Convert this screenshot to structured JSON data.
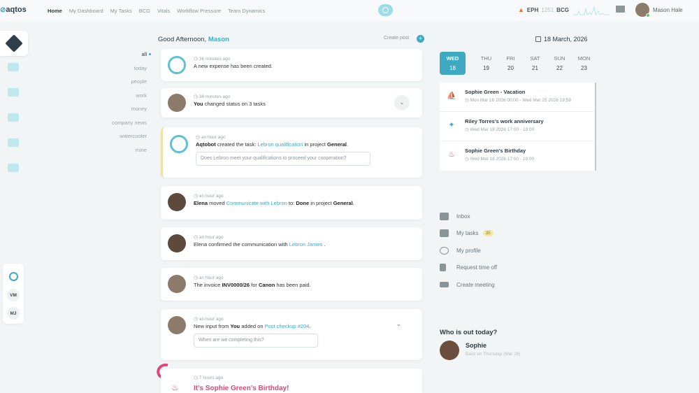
{
  "app": {
    "logo": "aqtos"
  },
  "nav": [
    "Home",
    "My Dashboard",
    "My Tasks",
    "BCG",
    "Vitals",
    "Workflow Pressure",
    "Team Dynamics"
  ],
  "ticker": {
    "eph_label": "EPH",
    "eph_value": "1251",
    "bcg_label": "BCG"
  },
  "user": {
    "name": "Mason Hale"
  },
  "greeting": {
    "prefix": "Good Afternoon,",
    "name": "Mason"
  },
  "create_post": "Create post",
  "filters": [
    "all",
    "today",
    "people",
    "work",
    "money",
    "company news",
    "watercooler",
    "mine"
  ],
  "feed": [
    {
      "time": "36 minutes ago",
      "text": "A new expense has been created."
    },
    {
      "time": "38 minutes ago",
      "actor": "You",
      "text": " changed status on 3 tasks"
    },
    {
      "time": "an hour ago",
      "actor": "Aqtobot",
      "pre": " created the task: ",
      "link": "Lebron qualification",
      "mid": " in project ",
      "project": "General",
      "end": ".",
      "reply_placeholder": "Does Lebron meet your qualifications to proceed your cooperation?"
    },
    {
      "time": "an hour ago",
      "actor": "Elena",
      "pre": " moved ",
      "link": "Communicate with Lebron",
      "mid": " to: ",
      "status": "Done",
      "mid2": " in project ",
      "project": "General",
      "end": "."
    },
    {
      "time": "an hour ago",
      "text": "Elena confirmed the communication with ",
      "link": "Lebron James",
      "end": " ."
    },
    {
      "time": "an hour ago",
      "pre": "The invoice ",
      "invoice": "INV0000/26",
      "mid": " for ",
      "client": "Canon",
      "end": " has been paid."
    },
    {
      "time": "an hour ago",
      "pre": "New input from ",
      "actor": "You",
      "mid": " added on ",
      "link": "Post checkup #204",
      "end": ".",
      "reply_placeholder": "When are we completing this?"
    },
    {
      "time": "7 hours ago",
      "title": "It's Sophie Green's Birthday!"
    }
  ],
  "calendar": {
    "date": "18 March, 2026",
    "days": [
      {
        "name": "WED",
        "num": "18"
      },
      {
        "name": "THU",
        "num": "19"
      },
      {
        "name": "FRI",
        "num": "20"
      },
      {
        "name": "SAT",
        "num": "21"
      },
      {
        "name": "SUN",
        "num": "22"
      },
      {
        "name": "MON",
        "num": "23"
      }
    ],
    "events": [
      {
        "title": "Sophie Green - Vacation",
        "date": "Mon Mar 16 2026 00:00 - Wed Mar 25 2026 19:59"
      },
      {
        "title": "Riley Torres's work anniversary",
        "date": "Wed Mar 18 2026 17:00 - 19:00"
      },
      {
        "title": "Sophie Green's Birthday",
        "date": "Wed Mar 18 2026 17:00 - 19:00"
      }
    ]
  },
  "quick_links": [
    {
      "label": "Inbox"
    },
    {
      "label": "My tasks",
      "badge": "35"
    },
    {
      "label": "My profile"
    },
    {
      "label": "Request time off"
    },
    {
      "label": "Create meeting"
    }
  ],
  "out_today": {
    "title": "Who is out today?",
    "name": "Sophie",
    "back": "Back on Thursday (Mar 26)"
  },
  "sidebar_initials": [
    "VM",
    "MJ"
  ]
}
